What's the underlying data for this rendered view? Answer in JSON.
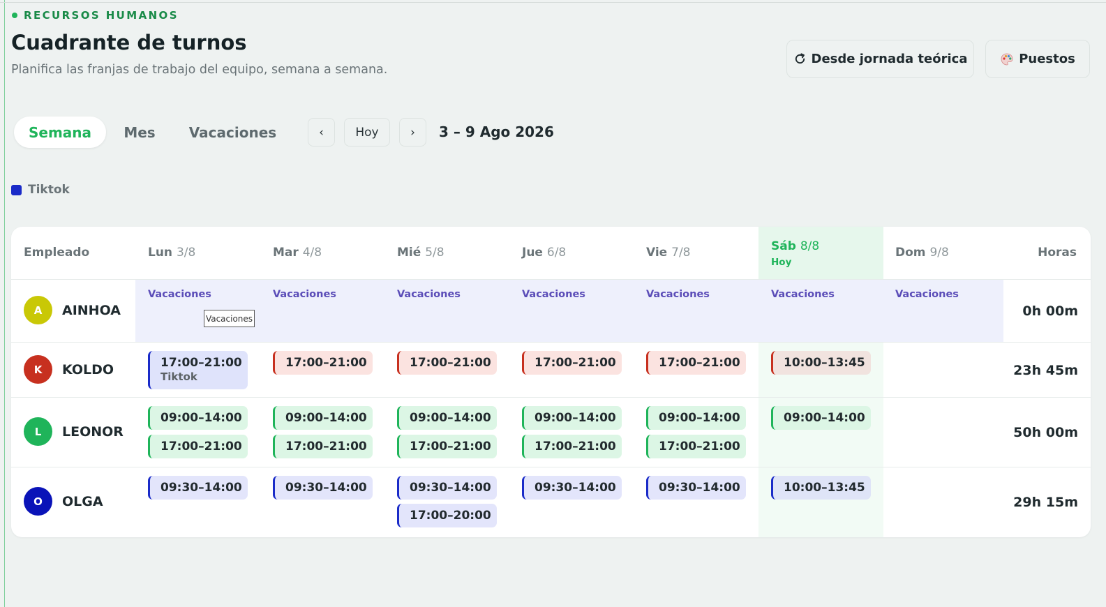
{
  "header": {
    "eyebrow": "RECURSOS HUMANOS",
    "title": "Cuadrante de turnos",
    "subtitle": "Planifica las franjas de trabajo del equipo, semana a semana.",
    "btn_theoretical": "Desde jornada teórica",
    "btn_positions": "Puestos"
  },
  "nav": {
    "tabs": [
      "Semana",
      "Mes",
      "Vacaciones"
    ],
    "active_tab": "Semana",
    "prev": "‹",
    "today": "Hoy",
    "next": "›",
    "range": "3 – 9 Ago 2026"
  },
  "legend": [
    {
      "label": "Tiktok",
      "color": "#1a2bc8"
    }
  ],
  "table": {
    "employee_header": "Empleado",
    "hours_header": "Horas",
    "today_label": "Hoy",
    "days": [
      {
        "name": "Lun",
        "date": "3/8"
      },
      {
        "name": "Mar",
        "date": "4/8"
      },
      {
        "name": "Mié",
        "date": "5/8"
      },
      {
        "name": "Jue",
        "date": "6/8"
      },
      {
        "name": "Vie",
        "date": "7/8"
      },
      {
        "name": "Sáb",
        "date": "8/8"
      },
      {
        "name": "Dom",
        "date": "9/8"
      }
    ],
    "vacation_label": "Vacaciones",
    "tooltip": "Vacaciones",
    "employees": [
      {
        "initial": "A",
        "name": "AINHOA",
        "avatar_color": "#c9c806",
        "hours": "0h 00m"
      },
      {
        "initial": "K",
        "name": "KOLDO",
        "avatar_color": "#c7301f",
        "hours": "23h 45m",
        "shifts": [
          {
            "time": "17:00–21:00",
            "position": "Tiktok"
          },
          {
            "time": "17:00–21:00"
          },
          {
            "time": "17:00–21:00"
          },
          {
            "time": "17:00–21:00"
          },
          {
            "time": "17:00–21:00"
          },
          {
            "time": "10:00–13:45"
          }
        ]
      },
      {
        "initial": "L",
        "name": "LEONOR",
        "avatar_color": "#1fb45a",
        "hours": "50h 00m",
        "shifts": [
          [
            "09:00–14:00",
            "17:00–21:00"
          ],
          [
            "09:00–14:00",
            "17:00–21:00"
          ],
          [
            "09:00–14:00",
            "17:00–21:00"
          ],
          [
            "09:00–14:00",
            "17:00–21:00"
          ],
          [
            "09:00–14:00",
            "17:00–21:00"
          ],
          [
            "09:00–14:00"
          ]
        ]
      },
      {
        "initial": "O",
        "name": "OLGA",
        "avatar_color": "#0a13b8",
        "hours": "29h 15m",
        "shifts": [
          [
            "09:30–14:00"
          ],
          [
            "09:30–14:00"
          ],
          [
            "09:30–14:00",
            "17:00–20:00"
          ],
          [
            "09:30–14:00"
          ],
          [
            "09:30–14:00"
          ],
          [
            "10:00–13:45"
          ]
        ]
      }
    ]
  }
}
